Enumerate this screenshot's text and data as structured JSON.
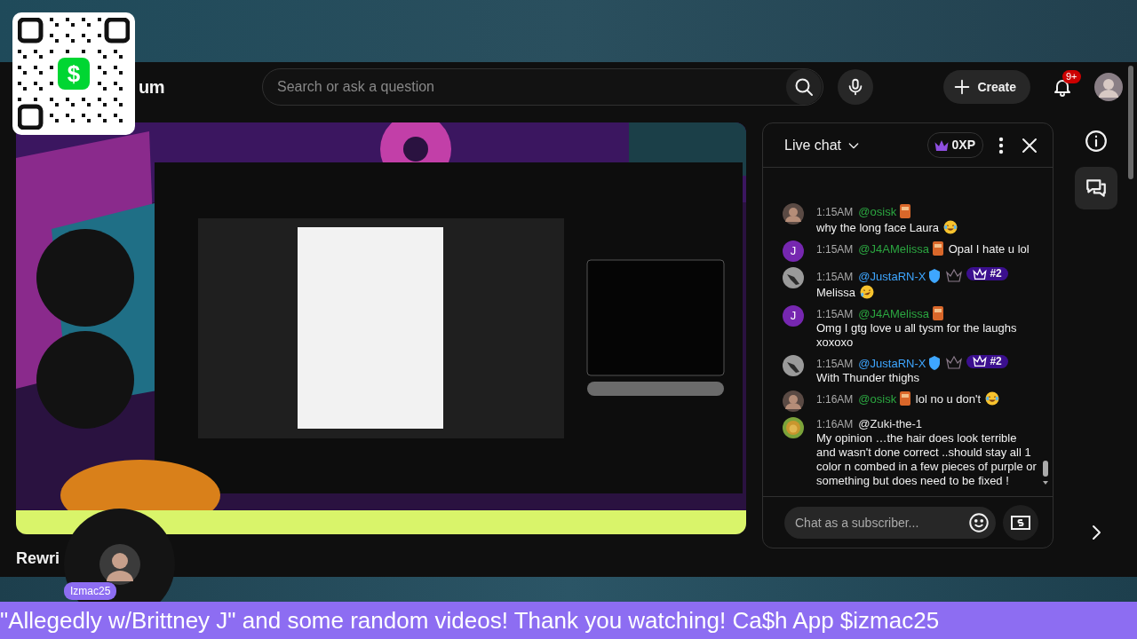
{
  "qr_code": {
    "logo": "$"
  },
  "header": {
    "logo_text": "um",
    "search": {
      "placeholder": "Search or ask a question"
    },
    "create_button": "Create",
    "notification_badge": "9+"
  },
  "video_title": "Rewri",
  "live_chat": {
    "title": "Live chat",
    "xp": "0XP",
    "messages": [
      {
        "time": "1:15AM",
        "author": "@osisk",
        "color": "#2ba640",
        "member_badge": true,
        "verified": false,
        "crown_badge": false,
        "text": "why the long face Laura",
        "emoji": {
          "kind": "tears-of-joy"
        }
      },
      {
        "avatar": {
          "kind": "letter",
          "letter": "J"
        },
        "time": "1:15AM",
        "author": "@J4AMelissa",
        "color": "#2ba640",
        "member_badge": true,
        "verified": false,
        "crown_badge": false,
        "text": "Opal I hate u lol"
      },
      {
        "avatar": {
          "kind": "bird"
        },
        "time": "1:15AM",
        "author": "@JustaRN-X",
        "color": "#3ea6ff",
        "member_badge": false,
        "verified": true,
        "crown_badge": true,
        "rank": "#2",
        "text": "Melissa",
        "emoji": {
          "kind": "rofl"
        }
      },
      {
        "avatar": {
          "kind": "letter",
          "letter": "J"
        },
        "time": "1:15AM",
        "author": "@J4AMelissa",
        "color": "#2ba640",
        "member_badge": true,
        "verified": false,
        "crown_badge": false,
        "text": "Omg I gtg love u all tysm for the laughs xoxoxo"
      },
      {
        "avatar": {
          "kind": "bird"
        },
        "time": "1:15AM",
        "author": "@JustaRN-X",
        "color": "#3ea6ff",
        "member_badge": false,
        "verified": true,
        "crown_badge": true,
        "rank": "#2",
        "text": "With Thunder thighs"
      },
      {
        "time": "1:16AM",
        "author": "@osisk",
        "color": "#2ba640",
        "member_badge": true,
        "verified": false,
        "crown_badge": false,
        "text": "lol no u don't",
        "emoji": {
          "kind": "tears-of-joy"
        }
      },
      {
        "avatar": {
          "kind": "lion"
        },
        "time": "1:16AM",
        "author": "@Zuki-the-1",
        "color": "#e8e8e8",
        "member_badge": false,
        "verified": false,
        "crown_badge": false,
        "text": "My opinion …the hair does look terrible and wasn't done correct ..should stay all 1 color n combed in a few pieces of purple or something but does need to be fixed !"
      }
    ],
    "input": {
      "placeholder": "Chat as a subscriber..."
    }
  },
  "overlay": {
    "guest_label": "Izmac25",
    "ticker": "\"Allegedly w/Brittney J\" and some random videos! Thank you watching! Ca$h App $izmac25"
  }
}
